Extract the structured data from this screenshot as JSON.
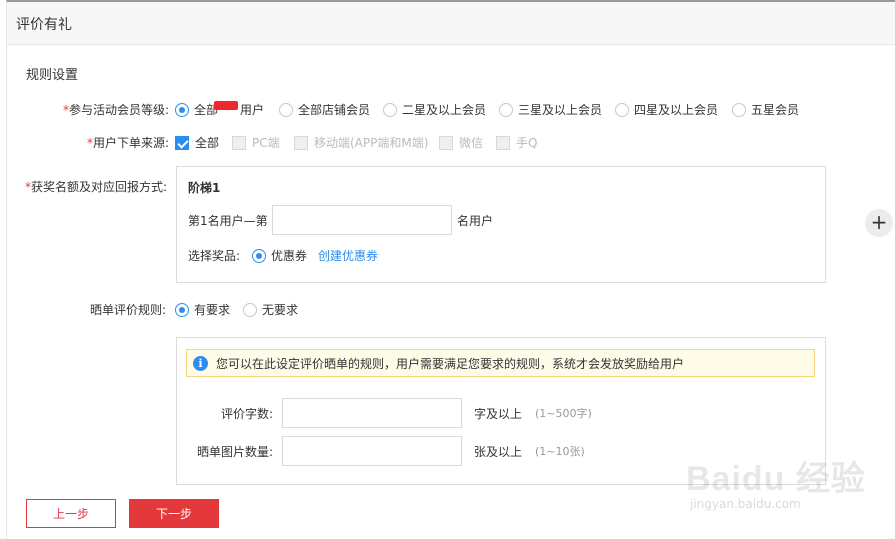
{
  "header": {
    "title": "评价有礼"
  },
  "section_title": "规则设置",
  "member_level": {
    "label": "参与活动会员等级:",
    "options": [
      {
        "label": "全部",
        "label_suffix": "用户",
        "selected": true
      },
      {
        "label": "全部店铺会员",
        "selected": false
      },
      {
        "label": "二星及以上会员",
        "selected": false
      },
      {
        "label": "三星及以上会员",
        "selected": false
      },
      {
        "label": "四星及以上会员",
        "selected": false
      },
      {
        "label": "五星会员",
        "selected": false
      }
    ]
  },
  "order_source": {
    "label": "用户下单来源:",
    "options": [
      {
        "label": "全部",
        "checked": true,
        "disabled": false
      },
      {
        "label": "PC端",
        "checked": false,
        "disabled": true
      },
      {
        "label": "移动端(APP端和M端)",
        "checked": false,
        "disabled": true
      },
      {
        "label": "微信",
        "checked": false,
        "disabled": true
      },
      {
        "label": "手Q",
        "checked": false,
        "disabled": true
      }
    ]
  },
  "reward": {
    "label": "获奖名额及对应回报方式:",
    "tier_title": "阶梯1",
    "rank_prefix": "第1名用户—第",
    "rank_input": "",
    "rank_suffix": "名用户",
    "prize_label": "选择奖品:",
    "prize_option": "优惠券",
    "create_link": "创建优惠券"
  },
  "review_rule": {
    "label": "晒单评价规则:",
    "options": [
      {
        "label": "有要求",
        "selected": true
      },
      {
        "label": "无要求",
        "selected": false
      }
    ],
    "info_text": "您可以在此设定评价晒单的规则，用户需要满足您要求的规则，系统才会发放奖励给用户",
    "word_count": {
      "label": "评价字数:",
      "value": "",
      "suffix": "字及以上",
      "hint": "(1~500字)"
    },
    "image_count": {
      "label": "晒单图片数量:",
      "value": "",
      "suffix": "张及以上",
      "hint": "(1~10张)"
    }
  },
  "buttons": {
    "prev": "上一步",
    "next": "下一步"
  },
  "add_icon": "plus-icon",
  "watermark": {
    "text": "Baidu 经验",
    "url_text": "jingyan.baidu.com"
  },
  "colors": {
    "accent": "#2d8cf0",
    "primary_red": "#e4393c",
    "redaction": "#f0262f"
  }
}
